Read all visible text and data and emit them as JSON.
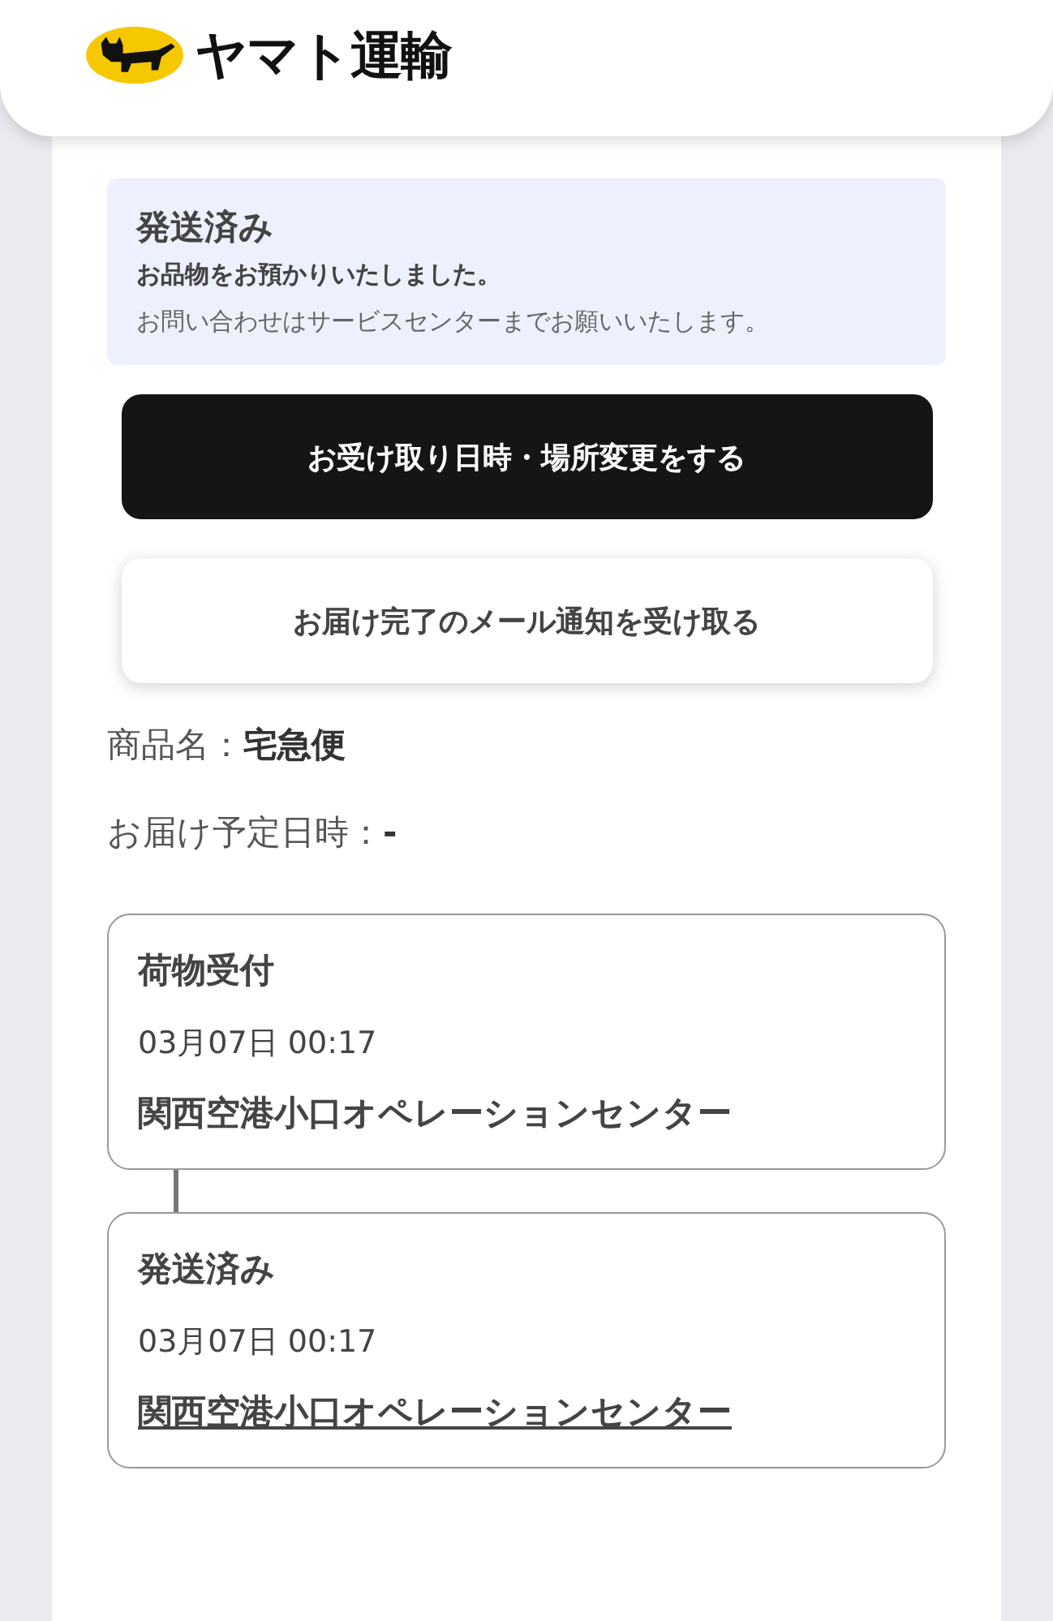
{
  "header": {
    "logo_text": "ヤマト運輸"
  },
  "status": {
    "title": "発送済み",
    "message": "お品物をお預かりいたしました。",
    "note": "お問い合わせはサービスセンターまでお願いいたします。"
  },
  "buttons": [
    {
      "label": "お受け取り日時・場所変更をする",
      "kind": "primary"
    },
    {
      "label": "お届け完了のメール通知を受け取る",
      "kind": "secondary"
    }
  ],
  "details": [
    {
      "label": "商品名：",
      "value": "宅急便"
    },
    {
      "label": "お届け予定日時：",
      "value": "-"
    }
  ],
  "timeline": [
    {
      "status": "荷物受付",
      "datetime": "03月07日 00:17",
      "location": "関西空港小口オペレーションセンター",
      "link": false
    },
    {
      "status": "発送済み",
      "datetime": "03月07日 00:17",
      "location": "関西空港小口オペレーションセンター",
      "link": true
    }
  ]
}
